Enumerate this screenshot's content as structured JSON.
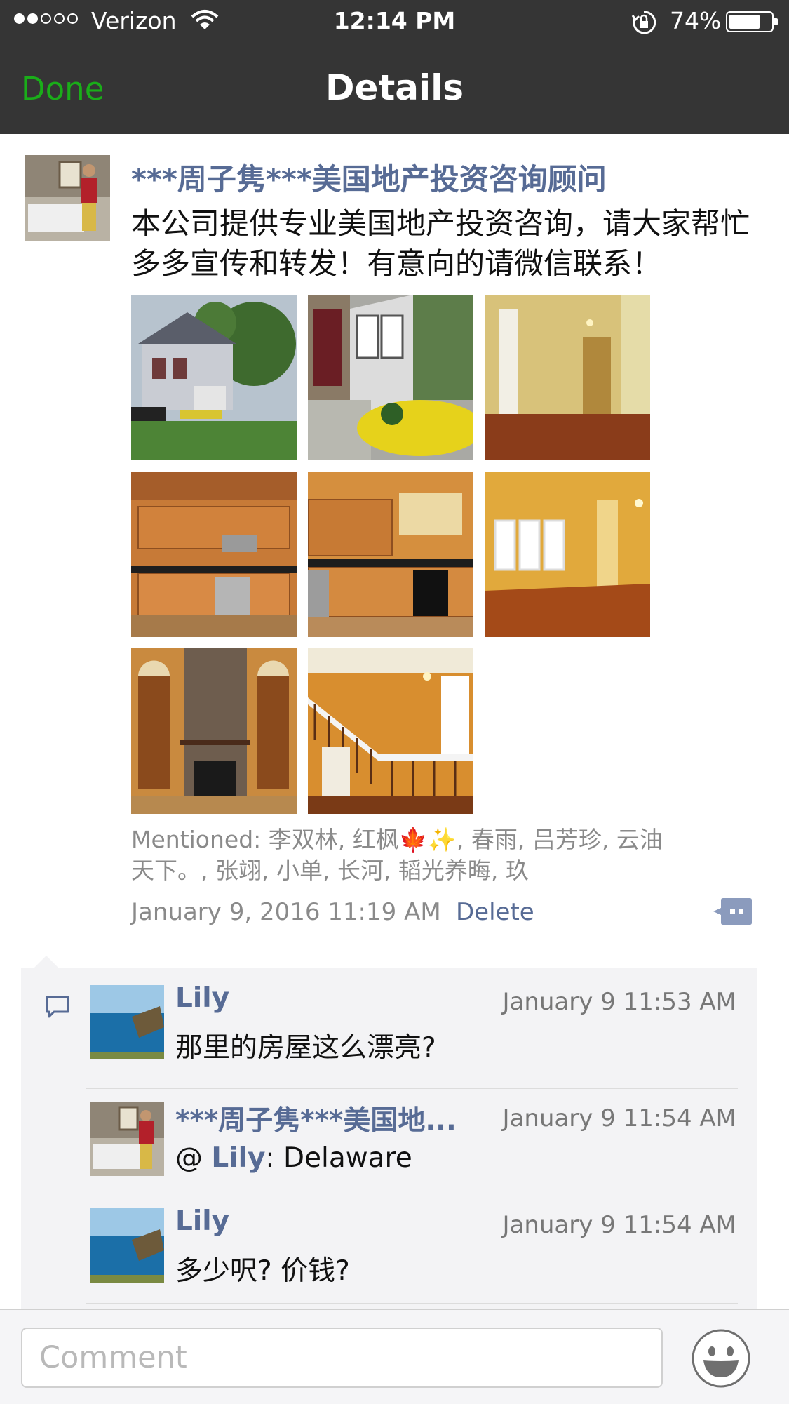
{
  "status_bar": {
    "carrier": "Verizon",
    "time": "12:14 PM",
    "battery": "74%",
    "battery_level": 0.74
  },
  "nav": {
    "done_label": "Done",
    "title": "Details"
  },
  "post": {
    "author": "***周子隽***美国地产投资咨询顾问",
    "text": "本公司提供专业美国地产投资咨询，请大家帮忙多多宣传和转发！有意向的请微信联系！",
    "mentioned": "Mentioned: 李双林, 红枫🍁✨, 春雨, 吕芳珍, 云油天下。, 张翊, 小单, 长河, 韬光养晦, 玖",
    "timestamp": "January 9, 2016 11:19 AM",
    "delete_label": "Delete"
  },
  "comments": [
    {
      "author": "Lily",
      "time": "January 9 11:53 AM",
      "text": "那里的房屋这么漂亮?"
    },
    {
      "author": "***周子隽***美国地...",
      "time": "January 9 11:54 AM",
      "text_prefix": "@ ",
      "mention": "Lily",
      "text_suffix": ": Delaware"
    },
    {
      "author": "Lily",
      "time": "January 9 11:54 AM",
      "text": "多少呎? 价钱?"
    }
  ],
  "comment_bar": {
    "placeholder": "Comment"
  },
  "colors": {
    "nav_bg": "#353535",
    "done_green": "#1aad19",
    "link_blue": "#576b95",
    "panel_bg": "#f3f3f5"
  }
}
